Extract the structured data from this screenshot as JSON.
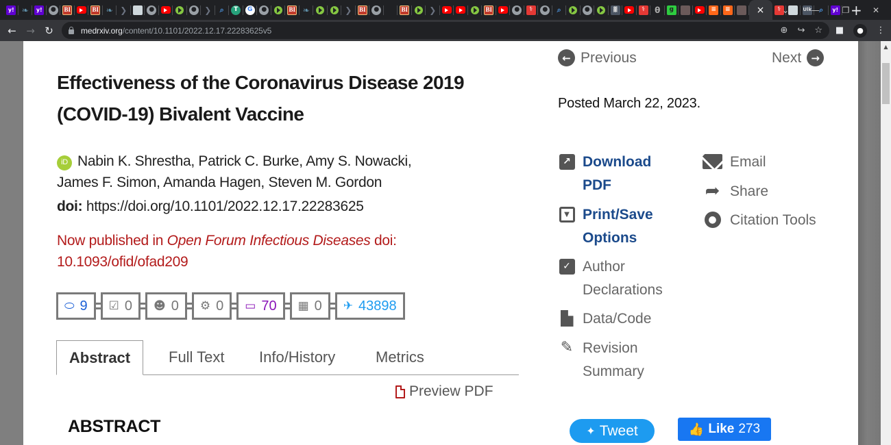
{
  "browser": {
    "tabs": [
      {
        "icon": "yahoo-icon",
        "glyph": "y!"
      },
      {
        "icon": "feather-icon",
        "glyph": "❧"
      },
      {
        "icon": "yahoo-icon",
        "glyph": "y!"
      },
      {
        "icon": "globe-icon",
        "glyph": "●"
      },
      {
        "icon": "business-insider-icon",
        "glyph": "BI"
      },
      {
        "icon": "youtube-icon",
        "glyph": ""
      },
      {
        "icon": "business-insider-icon",
        "glyph": "BI"
      },
      {
        "icon": "feather-icon",
        "glyph": "❧"
      },
      {
        "icon": "arrow-icon",
        "glyph": "❯"
      },
      {
        "icon": "map-icon",
        "glyph": ""
      },
      {
        "icon": "globe-icon",
        "glyph": "●"
      },
      {
        "icon": "youtube-icon",
        "glyph": ""
      },
      {
        "icon": "rumble-icon",
        "glyph": ""
      },
      {
        "icon": "globe-icon",
        "glyph": "●"
      },
      {
        "icon": "arrow-icon",
        "glyph": "❯"
      },
      {
        "icon": "search-icon",
        "glyph": "⌕"
      },
      {
        "icon": "tether-icon",
        "glyph": "T"
      },
      {
        "icon": "google-icon",
        "glyph": "G"
      },
      {
        "icon": "globe-icon",
        "glyph": "●"
      },
      {
        "icon": "rumble-icon",
        "glyph": ""
      },
      {
        "icon": "business-insider-icon",
        "glyph": "BI"
      },
      {
        "icon": "feather-icon",
        "glyph": "❧"
      },
      {
        "icon": "rumble-icon",
        "glyph": ""
      },
      {
        "icon": "rumble-icon",
        "glyph": ""
      },
      {
        "icon": "arrow-icon",
        "glyph": "❯"
      },
      {
        "icon": "business-insider-icon",
        "glyph": "BI"
      },
      {
        "icon": "globe-icon",
        "glyph": "●"
      },
      {
        "icon": "blank-icon",
        "glyph": ""
      },
      {
        "icon": "business-insider-icon",
        "glyph": "BI"
      },
      {
        "icon": "rumble-icon",
        "glyph": ""
      },
      {
        "icon": "arrow-icon",
        "glyph": "❯"
      },
      {
        "icon": "youtube-icon",
        "glyph": ""
      },
      {
        "icon": "youtube-icon",
        "glyph": ""
      },
      {
        "icon": "rumble-icon",
        "glyph": ""
      },
      {
        "icon": "business-insider-icon",
        "glyph": "BI"
      },
      {
        "icon": "youtube-icon",
        "glyph": ""
      },
      {
        "icon": "globe-icon",
        "glyph": "●"
      },
      {
        "icon": "medrxiv-icon",
        "glyph": "⚕"
      },
      {
        "icon": "globe-icon",
        "glyph": "●"
      },
      {
        "icon": "search-icon",
        "glyph": "⌕"
      },
      {
        "icon": "rumble-icon",
        "glyph": ""
      },
      {
        "icon": "globe-icon",
        "glyph": "●"
      },
      {
        "icon": "rumble-icon",
        "glyph": ""
      },
      {
        "icon": "chart-icon",
        "glyph": "▓"
      },
      {
        "icon": "youtube-icon",
        "glyph": ""
      },
      {
        "icon": "medrxiv-icon",
        "glyph": "⚕"
      },
      {
        "icon": "theta-icon",
        "glyph": "θ"
      },
      {
        "icon": "gab-icon",
        "glyph": "g"
      },
      {
        "icon": "photo-icon",
        "glyph": ""
      },
      {
        "icon": "youtube-icon",
        "glyph": ""
      },
      {
        "icon": "substack-icon",
        "glyph": "≡"
      },
      {
        "icon": "substack-icon",
        "glyph": "≡"
      },
      {
        "icon": "photo-icon",
        "glyph": ""
      },
      {
        "icon": "active-tab",
        "glyph": "×",
        "active": true
      },
      {
        "icon": "medrxiv-icon",
        "glyph": "⚕"
      },
      {
        "icon": "map-icon",
        "glyph": ""
      },
      {
        "icon": "chart-icon",
        "glyph": "Ulk"
      },
      {
        "icon": "search-icon",
        "glyph": "⌕"
      },
      {
        "icon": "yahoo-icon",
        "glyph": "y!"
      }
    ],
    "new_tab": "+",
    "window_controls": {
      "list": "⌄",
      "minimize": "—",
      "restore": "❐",
      "close": "✕"
    },
    "nav": {
      "back": "←",
      "forward": "→",
      "reload": "↻"
    },
    "url_host": "medrxiv.org",
    "url_path": "/content/10.1101/2022.12.17.22283625v5",
    "omni_icons": {
      "zoom": "⊕",
      "share": "↪",
      "bookmark": "☆"
    },
    "toolbar_icons": {
      "sidepanel": "■",
      "profile": "●",
      "menu": "⋮"
    }
  },
  "article": {
    "title": "Effectiveness of the Coronavirus Disease 2019 (COVID-19) Bivalent Vaccine",
    "orcid_label": "iD",
    "authors_line1": "Nabin K. Shrestha, Patrick C. Burke, Amy S. Nowacki,",
    "authors_line2": "James F. Simon, Amanda Hagen, Steven M. Gordon",
    "doi_label": "doi:",
    "doi_value": "https://doi.org/10.1101/2022.12.17.22283625",
    "published_prefix": "Now published in ",
    "published_journal": "Open Forum Infectious Diseases",
    "published_doi": " doi: 10.1093/ofid/ofad209",
    "metrics": [
      {
        "name": "comments",
        "icon": "⬭",
        "value": "9",
        "color": "#1a5fd6"
      },
      {
        "name": "peer-review",
        "icon": "☑",
        "value": "0",
        "color": "#777777"
      },
      {
        "name": "community",
        "icon": "☻",
        "value": "0",
        "color": "#777777"
      },
      {
        "name": "automated-services",
        "icon": "⚙",
        "value": "0",
        "color": "#777777"
      },
      {
        "name": "blogs",
        "icon": "▭",
        "value": "70",
        "color": "#8a14b8"
      },
      {
        "name": "media",
        "icon": "▦",
        "value": "0",
        "color": "#777777"
      },
      {
        "name": "twitter",
        "icon": "✈",
        "value": "43898",
        "color": "#1d9bf0"
      }
    ],
    "tabs": [
      {
        "label": "Abstract",
        "active": true
      },
      {
        "label": "Full Text"
      },
      {
        "label": "Info/History"
      },
      {
        "label": "Metrics"
      }
    ],
    "preview_pdf": "Preview PDF",
    "abstract_heading": "ABSTRACT"
  },
  "sidebar": {
    "previous": "Previous",
    "next": "Next",
    "posted": "Posted March 22, 2023.",
    "actions_left": [
      {
        "id": "download-pdf",
        "line1": "Download",
        "line2": "PDF",
        "primary": true
      },
      {
        "id": "print-save",
        "line1": "Print/Save",
        "line2": "Options",
        "primary": true
      },
      {
        "id": "author-declarations",
        "line1": "Author",
        "line2": "Declarations"
      },
      {
        "id": "data-code",
        "line1": "Data/Code"
      },
      {
        "id": "revision-summary",
        "line1": "Revision",
        "line2": "Summary"
      }
    ],
    "actions_right": [
      {
        "id": "email",
        "label": "Email"
      },
      {
        "id": "share",
        "label": "Share"
      },
      {
        "id": "citation-tools",
        "label": "Citation Tools"
      }
    ],
    "tweet_label": "Tweet",
    "like_label": "Like",
    "like_count": "273"
  },
  "colors": {
    "link_blue": "#1b4a8b",
    "published_red": "#b31b1b",
    "icon_gray": "#555555",
    "twitter_blue": "#1d9bf0",
    "facebook_blue": "#1877f2",
    "orcid_green": "#a6ce39"
  }
}
